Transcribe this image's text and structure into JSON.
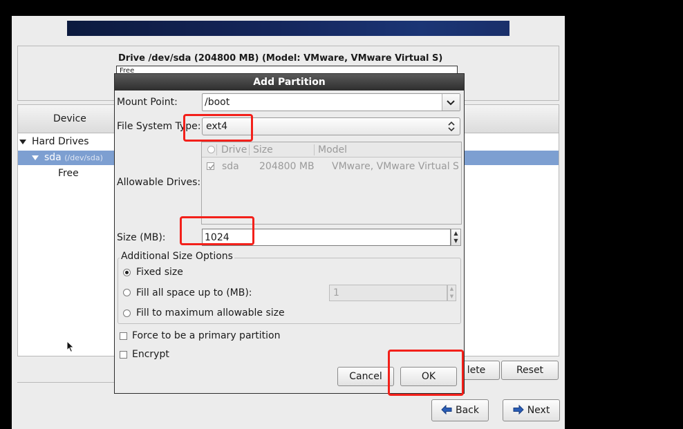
{
  "drive_panel": {
    "title": "Drive /dev/sda (204800 MB) (Model: VMware, VMware Virtual S)",
    "bar_label": "Free"
  },
  "tree": {
    "column_device": "Device",
    "hard_drives": "Hard Drives",
    "sda": "sda",
    "sda_path": "(/dev/sda)",
    "free": "Free"
  },
  "buttons": {
    "delete": "lete",
    "reset": "Reset",
    "back": "Back",
    "next": "Next"
  },
  "dialog": {
    "title": "Add Partition",
    "mount_point_label": "Mount Point:",
    "mount_point_value": "/boot",
    "fs_type_label": "File System Type:",
    "fs_type_value": "ext4",
    "allowable_drives_label": "Allowable Drives:",
    "drives_columns": [
      "Drive",
      "Size",
      "Model"
    ],
    "drives_rows": [
      {
        "checked": true,
        "drive": "sda",
        "size": "204800 MB",
        "model": "VMware, VMware Virtual S"
      }
    ],
    "size_label": "Size (MB):",
    "size_value": "1024",
    "size_options_legend": "Additional Size Options",
    "opt_fixed": "Fixed size",
    "opt_fill_upto": "Fill all space up to (MB):",
    "fill_upto_value": "1",
    "opt_fill_max": "Fill to maximum allowable size",
    "selected_option": "Fixed size",
    "force_primary": "Force to be a primary partition",
    "encrypt": "Encrypt",
    "cancel": "Cancel",
    "ok": "OK"
  },
  "highlight_color": "#f3201a",
  "selection_color": "#7d9fd1"
}
